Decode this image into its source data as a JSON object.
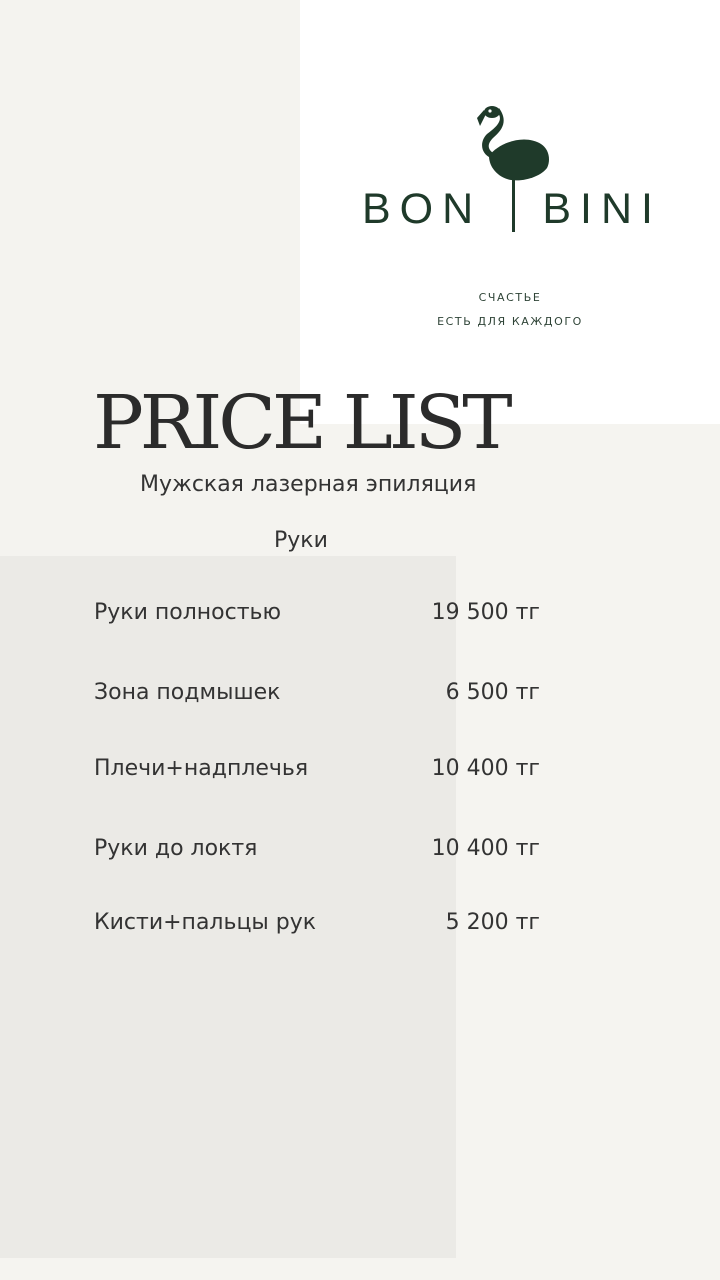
{
  "brand": {
    "name_left": "BON",
    "name_right": "BINI",
    "tagline_line1": "СЧАСТЬЕ",
    "tagline_line2": "ЕСТЬ ДЛЯ КАЖДОГО",
    "color": "#1f3a2a",
    "icon": "flamingo-icon"
  },
  "header": {
    "title": "PRICE LIST",
    "subtitle": "Мужская лазерная эпиляция"
  },
  "section": {
    "title": "Руки",
    "items": [
      {
        "name": "Руки полностью",
        "price": "19 500 тг"
      },
      {
        "name": "Зона подмышек",
        "price": "6 500 тг"
      },
      {
        "name": "Плечи+надплечья",
        "price": "10 400 тг"
      },
      {
        "name": "Руки до локтя",
        "price": "10 400 тг"
      },
      {
        "name": "Кисти+пальцы рук",
        "price": "5 200 тг"
      }
    ]
  }
}
